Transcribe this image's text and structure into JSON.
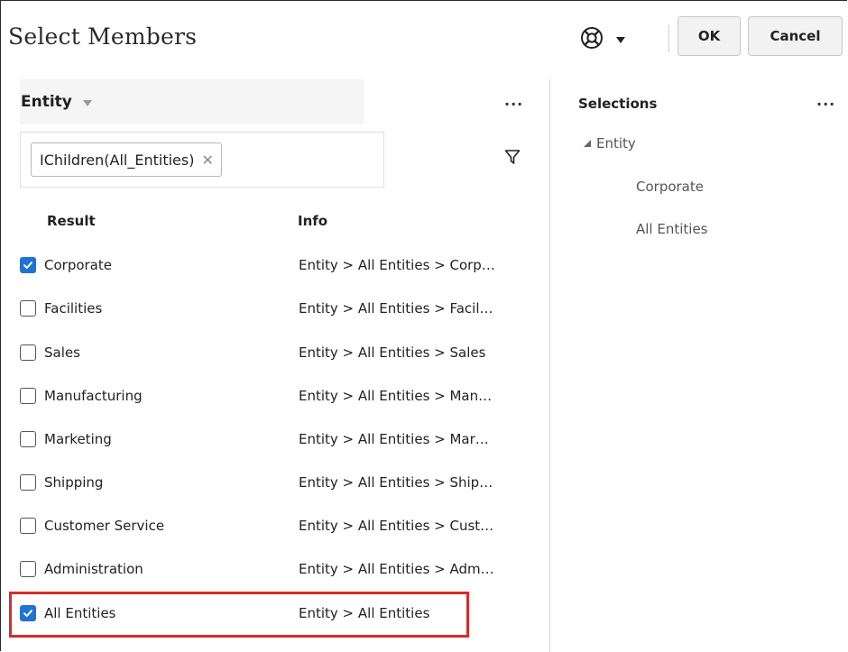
{
  "dialog": {
    "title": "Select Members",
    "ok_label": "OK",
    "cancel_label": "Cancel",
    "help_icon": "lifebuoy-icon"
  },
  "dimension": {
    "label": "Entity",
    "more_label": "···"
  },
  "search": {
    "chip_label": "IChildren(All_Entities)",
    "chip_remove": "✕"
  },
  "table": {
    "headers": {
      "result": "Result",
      "info": "Info"
    },
    "rows": [
      {
        "name": "Corporate",
        "info": "Entity > All Entities > Corp…",
        "checked": true
      },
      {
        "name": "Facilities",
        "info": "Entity > All Entities > Facil…",
        "checked": false
      },
      {
        "name": "Sales",
        "info": "Entity > All Entities > Sales",
        "checked": false
      },
      {
        "name": "Manufacturing",
        "info": "Entity > All Entities > Man…",
        "checked": false
      },
      {
        "name": "Marketing",
        "info": "Entity > All Entities > Mar…",
        "checked": false
      },
      {
        "name": "Shipping",
        "info": "Entity > All Entities > Ship…",
        "checked": false
      },
      {
        "name": "Customer Service",
        "info": "Entity > All Entities > Cust…",
        "checked": false
      },
      {
        "name": "Administration",
        "info": "Entity > All Entities > Adm…",
        "checked": false
      },
      {
        "name": "All Entities",
        "info": "Entity > All Entities",
        "checked": true
      }
    ]
  },
  "selections": {
    "title": "Selections",
    "more_label": "···",
    "dimension": "Entity",
    "items": [
      "Corporate",
      "All Entities"
    ]
  },
  "colors": {
    "accent": "#1f72d6",
    "highlight": "#d92b2b"
  }
}
